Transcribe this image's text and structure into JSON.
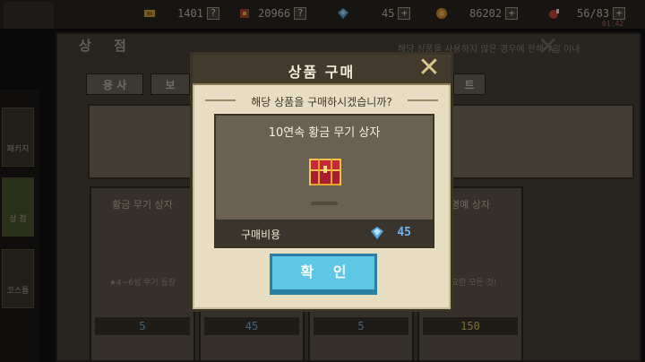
{
  "topbar": {
    "tickets": "1401",
    "medals": "20966",
    "gems": "45",
    "gold": "86202",
    "stamina": "56/83",
    "stamina_timer": "01:42"
  },
  "shop": {
    "title": "상 점",
    "notice": "해당 상품을 사용하지 않은 경우에 한해 7일 이내",
    "tabs": [
      "용 사",
      "보",
      "트"
    ],
    "sidebar": [
      "패키지",
      "상 점",
      "코스튬"
    ],
    "cards": [
      {
        "title": "황금 무기 상자",
        "note": "★4~6성 무기 등장",
        "price": "5"
      },
      {
        "title": "",
        "note": "",
        "price": "45"
      },
      {
        "title": "",
        "note": "",
        "price": "5"
      },
      {
        "title": "명예 상자",
        "note": "필요한 모든 것!",
        "price": "150"
      }
    ]
  },
  "dialog": {
    "title": "상품 구매",
    "question": "해당 상품을 구매하시겠습니까?",
    "item_name": "10연속 황금 무기 상자",
    "cost_label": "구매비용",
    "cost_value": "45",
    "confirm_label": "확 인"
  },
  "colors": {
    "accent_button": "#5fc7e6",
    "gem_blue": "#6fb4ee",
    "dialog_bg": "#e7ddc3"
  },
  "icons": [
    "ticket-icon",
    "medal-icon",
    "gem-icon",
    "gold-coin-icon",
    "meat-icon",
    "close-icon",
    "chest-icon"
  ]
}
